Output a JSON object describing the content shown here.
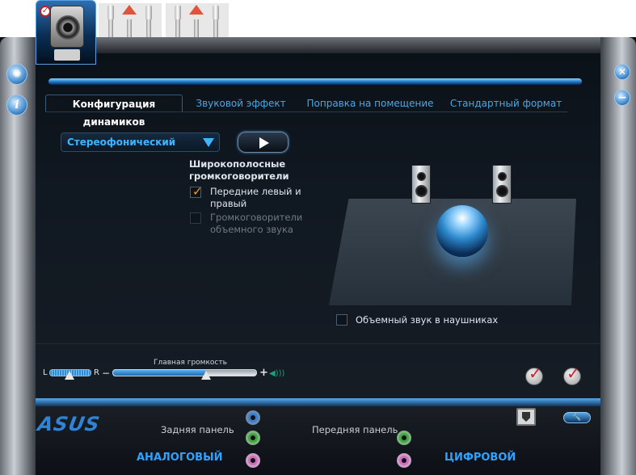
{
  "tabs": [
    {
      "label": "Конфигурация динамиков"
    },
    {
      "label": "Звуковой эффект"
    },
    {
      "label": "Поправка на помещение"
    },
    {
      "label": "Стандартный формат"
    }
  ],
  "speaker_config": {
    "mode_select_value": "Стереофонический",
    "fullrange_title": "Широкополосные громкоговорители",
    "front_checkbox_label": "Передние левый и правый",
    "front_checkbox_checked": true,
    "surround_checkbox_label": "Громкоговорители объемного звука",
    "surround_checkbox_checked": false,
    "headphones_checkbox_label": "Объемный звук в наушниках",
    "headphones_checkbox_checked": false
  },
  "volume": {
    "balance_left": "L",
    "balance_right": "R",
    "minus": "−",
    "plus": "+",
    "title": "Главная громкость",
    "level": 0.65
  },
  "bottom": {
    "logo": "ASUS",
    "rear_panel_label": "Задняя панель",
    "front_panel_label": "Передняя панель",
    "analog_label": "АНАЛОГОВЫЙ",
    "digital_label": "ЦИФРОВОЙ"
  },
  "colors": {
    "accent": "#3fb5ff",
    "tab_inactive": "#4aa7e6",
    "checkmark": "#f0a020"
  }
}
